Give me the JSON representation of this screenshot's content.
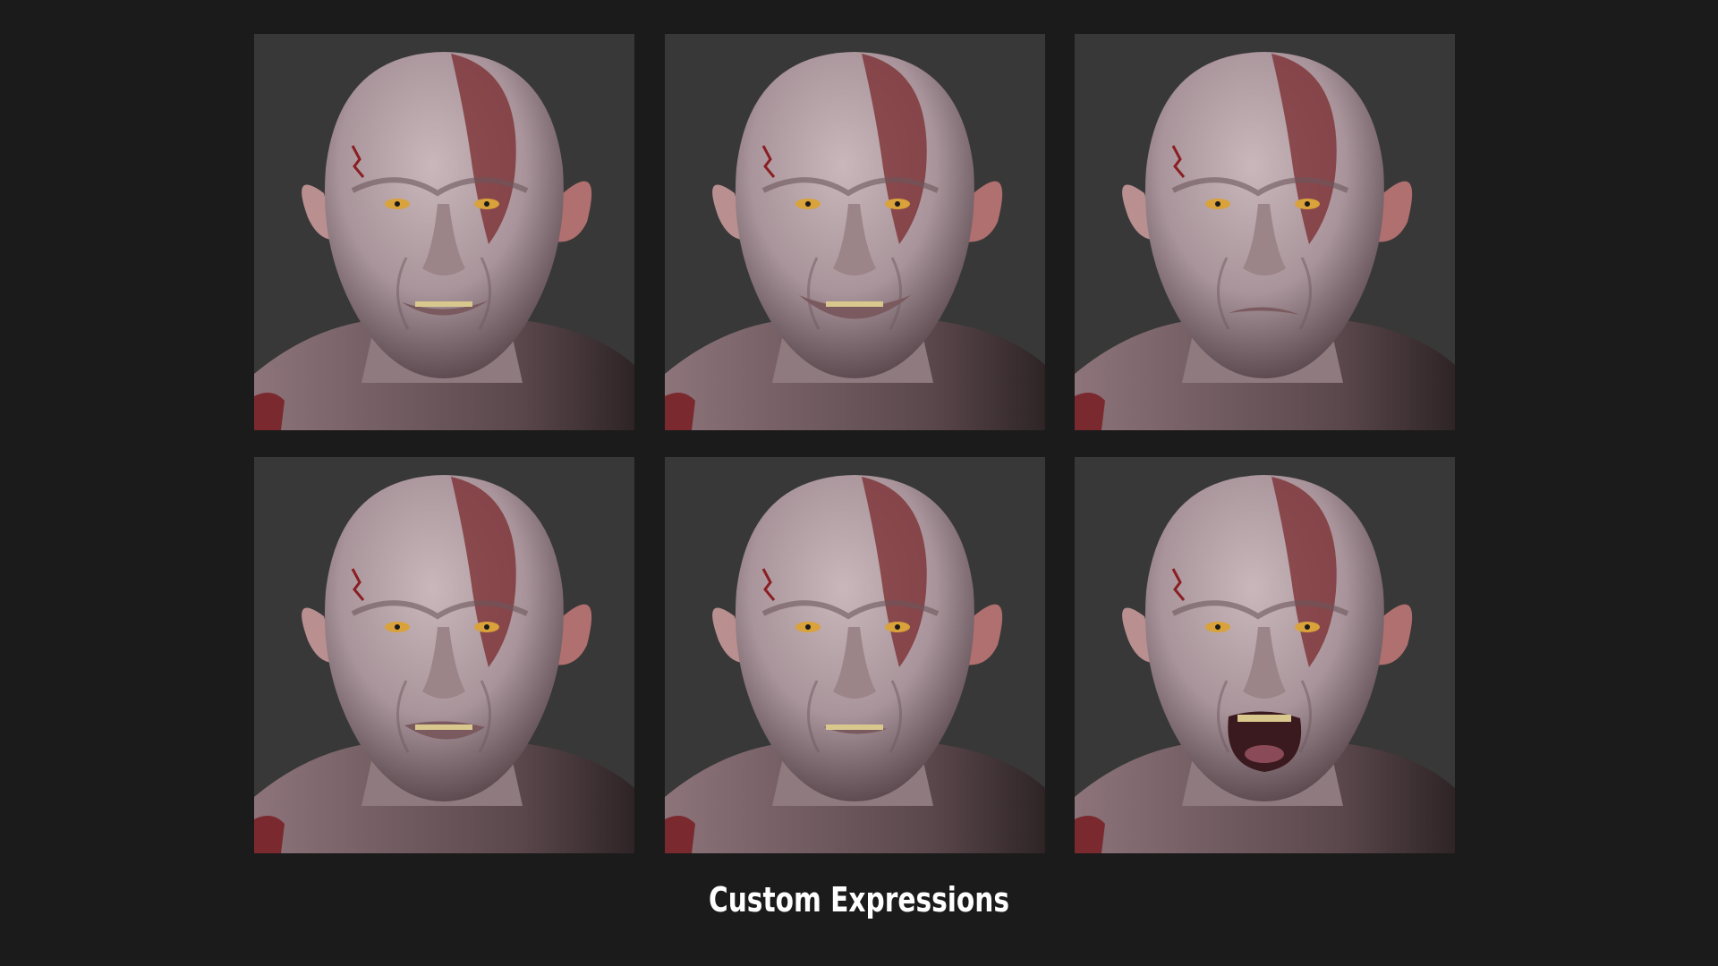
{
  "caption": "Custom Expressions",
  "tiles": [
    {
      "expression": "smirk",
      "mouth": "smile-teeth"
    },
    {
      "expression": "grin",
      "mouth": "wide-grin"
    },
    {
      "expression": "displeased",
      "mouth": "closed-frown"
    },
    {
      "expression": "snarl",
      "mouth": "clenched-teeth"
    },
    {
      "expression": "surprised",
      "mouth": "slightly-open"
    },
    {
      "expression": "roar",
      "mouth": "open-shout"
    }
  ],
  "colors": {
    "page_background": "#1b1b1b",
    "tile_background": "#383838",
    "skin": "#a8949a",
    "skin_shadow": "#5e4c52",
    "war_paint": "#7a2a2e",
    "eye": "#d9a23a",
    "caption_text": "#ffffff"
  }
}
